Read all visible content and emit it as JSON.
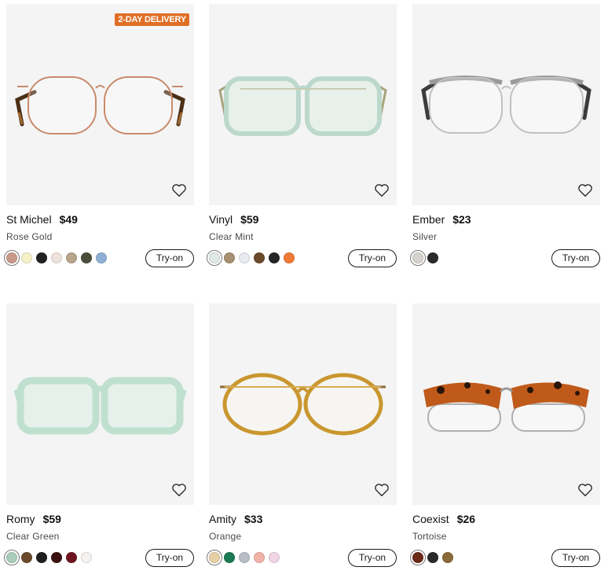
{
  "products": [
    {
      "badge": "2-DAY DELIVERY",
      "name": "St Michel",
      "price": "$49",
      "color": "Rose Gold",
      "try_on": "Try-on",
      "frame": {
        "rim": "#c98a6a",
        "temple": "#5a3a22",
        "temple_accent": "#8a5a2b",
        "shape": "round-metal"
      },
      "swatches": [
        "#c99a8a",
        "#f6f0c8",
        "#222222",
        "#ede3dc",
        "#b8a58c",
        "#4d4d3d",
        "#8fb0d4"
      ]
    },
    {
      "badge": "",
      "name": "Vinyl",
      "price": "$59",
      "color": "Clear Mint",
      "try_on": "Try-on",
      "frame": {
        "rim": "#bcd8cc",
        "temple": "#a7a37e",
        "temple_accent": "#c8cdb0",
        "shape": "square-acetate"
      },
      "swatches": [
        "#dfe9e3",
        "#a89072",
        "#e9ebf0",
        "#6b4a2c",
        "#262626",
        "#f07a36"
      ]
    },
    {
      "badge": "",
      "name": "Ember",
      "price": "$23",
      "color": "Silver",
      "try_on": "Try-on",
      "frame": {
        "rim": "#c0c0c0",
        "temple": "#3c3c3c",
        "temple_accent": "#777777",
        "shape": "browline-metal"
      },
      "swatches": [
        "#d6d3cf",
        "#2a2a2a"
      ]
    },
    {
      "badge": "",
      "name": "Romy",
      "price": "$59",
      "color": "Clear Green",
      "try_on": "Try-on",
      "frame": {
        "rim": "#bfe0cf",
        "temple": "#bfe0cf",
        "temple_accent": "#d5ece0",
        "shape": "square-thick"
      },
      "swatches": [
        "#a9cdb8",
        "#6b4a2c",
        "#1f1f1f",
        "#3a1010",
        "#6e1520",
        "#f5f2ef"
      ]
    },
    {
      "badge": "",
      "name": "Amity",
      "price": "$33",
      "color": "Orange",
      "try_on": "Try-on",
      "frame": {
        "rim": "#c9972f",
        "temple": "#8a6a3a",
        "temple_accent": "#d9aa50",
        "shape": "round-acetate"
      },
      "swatches": [
        "#e7cfa6",
        "#1b7a53",
        "#b9bfc6",
        "#f1b3a8",
        "#f1d5e6"
      ]
    },
    {
      "badge": "",
      "name": "Coexist",
      "price": "$26",
      "color": "Tortoise",
      "try_on": "Try-on",
      "frame": {
        "rim": "#b0b0b0",
        "temple": "#c05a1a",
        "temple_accent": "#2a1508",
        "shape": "browline-tortoise"
      },
      "swatches": [
        "#6b2a18",
        "#2a2a2a",
        "#8a6a3a"
      ]
    }
  ]
}
